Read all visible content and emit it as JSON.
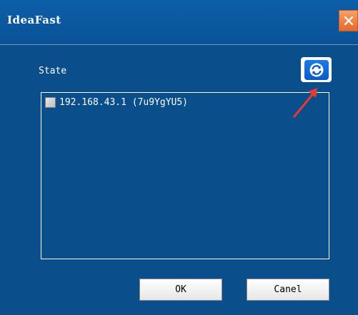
{
  "window": {
    "title": "IdeaFast"
  },
  "state": {
    "label": "State"
  },
  "list": {
    "items": [
      {
        "label": "192.168.43.1 (7u9YgYU5)",
        "checked": false
      }
    ]
  },
  "buttons": {
    "ok_label": "OK",
    "cancel_label": "Canel"
  },
  "icons": {
    "close": "close-icon",
    "refresh": "refresh-icon",
    "annotation": "red-arrow-annotation"
  },
  "colors": {
    "background": "#0a4e8c",
    "titlebar": "#0c5ea8",
    "close_button": "#e46a2a",
    "refresh_button": "#1a7be6",
    "annotation_arrow": "#e53935"
  }
}
